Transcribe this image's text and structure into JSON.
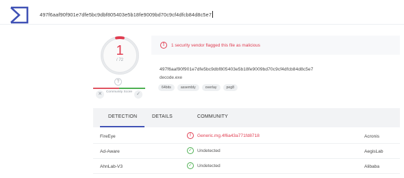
{
  "search": {
    "value": "497f6aaf90f901e7dfe5bc9dbf805403e5b18fe9009bd70c9cf4dfcb84d8c5e7"
  },
  "score": {
    "detections": "1",
    "total": "/ 72",
    "ring_fraction": 0.0139
  },
  "community": {
    "question_mark": "?",
    "label": "Community Score",
    "downvote_icon": "x-icon",
    "upvote_icon": "check-icon"
  },
  "alert": {
    "icon": "!",
    "text": "1 security vendor flagged this file as malicious"
  },
  "file": {
    "hash": "497f6aaf90f901e7dfe5bc9dbf805403e5b18fe9009bd70c9cf4dfcb84d8c5e7",
    "name": "decode.exe",
    "tags": [
      "64bits",
      "assembly",
      "overlay",
      "peg8"
    ]
  },
  "tabs": [
    {
      "label": "DETECTION",
      "active": true
    },
    {
      "label": "DETAILS",
      "active": false
    },
    {
      "label": "COMMUNITY",
      "active": false
    }
  ],
  "rows": [
    {
      "engine": "FireEye",
      "result": "Generic.mg.4f6a43a771fd8718",
      "status": "malicious",
      "vendor": "Acronis",
      "icon": "!"
    },
    {
      "engine": "Ad-Aware",
      "result": "Undetected",
      "status": "clean",
      "vendor": "AegisLab",
      "icon": "✓"
    },
    {
      "engine": "AhnLab-V3",
      "result": "Undetected",
      "status": "clean",
      "vendor": "Alibaba",
      "icon": "✓"
    }
  ],
  "colors": {
    "brand": "#3f51b5",
    "malicious": "#e03b4f",
    "clean": "#4caf50"
  }
}
